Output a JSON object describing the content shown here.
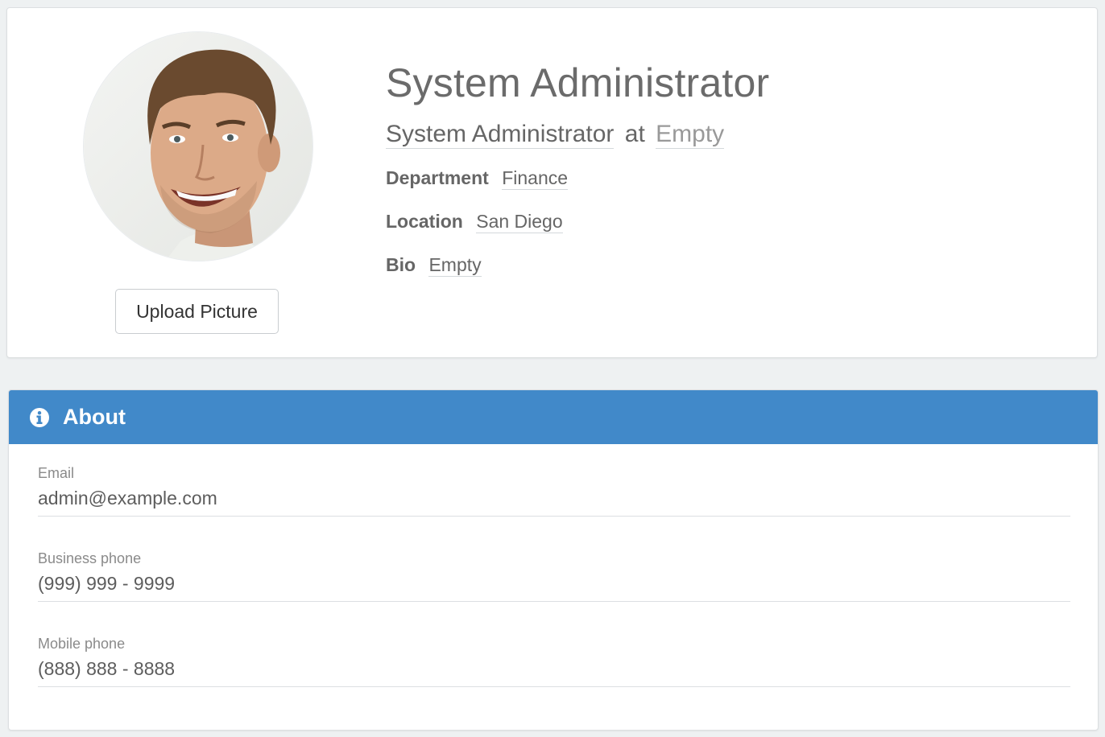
{
  "profile": {
    "name": "System Administrator",
    "job_title": "System Administrator",
    "at_word": "at",
    "company": "Empty",
    "upload_label": "Upload Picture",
    "fields": {
      "department": {
        "label": "Department",
        "value": "Finance"
      },
      "location": {
        "label": "Location",
        "value": "San Diego"
      },
      "bio": {
        "label": "Bio",
        "value": "Empty"
      }
    }
  },
  "about": {
    "title": "About",
    "icon": "info-icon",
    "accent_color": "#4189c9",
    "email": {
      "label": "Email",
      "value": "admin@example.com"
    },
    "business_phone": {
      "label": "Business phone",
      "value": "(999) 999 - 9999"
    },
    "mobile_phone": {
      "label": "Mobile phone",
      "value": "(888) 888 - 8888"
    }
  }
}
